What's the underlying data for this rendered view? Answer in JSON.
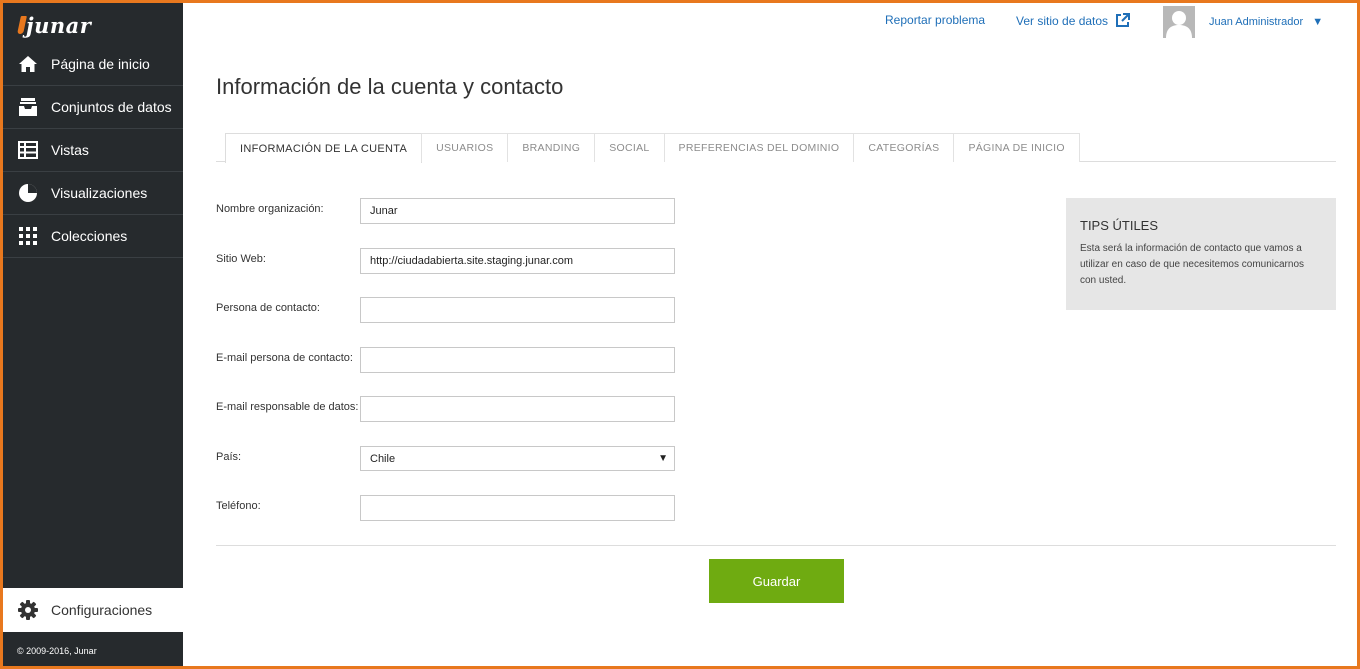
{
  "brand": {
    "logo_text": "junar",
    "accent": "#e8781e"
  },
  "sidebar": {
    "items": [
      {
        "label": "Página de inicio",
        "icon": "home-icon"
      },
      {
        "label": "Conjuntos de datos",
        "icon": "inbox-icon"
      },
      {
        "label": "Vistas",
        "icon": "table-icon"
      },
      {
        "label": "Visualizaciones",
        "icon": "pie-chart-icon"
      },
      {
        "label": "Colecciones",
        "icon": "grid-icon"
      }
    ],
    "settings_label": "Configuraciones",
    "copyright": "© 2009-2016, Junar"
  },
  "header": {
    "report_link": "Reportar problema",
    "view_site_link": "Ver sitio de datos",
    "user_name": "Juan Administrador",
    "user_caret": "▼"
  },
  "page": {
    "title": "Información de la cuenta y contacto"
  },
  "tabs": [
    {
      "label": "INFORMACIÓN DE LA CUENTA",
      "active": true
    },
    {
      "label": "USUARIOS"
    },
    {
      "label": "BRANDING"
    },
    {
      "label": "SOCIAL"
    },
    {
      "label": "PREFERENCIAS DEL DOMINIO"
    },
    {
      "label": "CATEGORÍAS"
    },
    {
      "label": "PÁGINA DE INICIO"
    }
  ],
  "form": {
    "org_name": {
      "label": "Nombre organización:",
      "value": "Junar"
    },
    "website": {
      "label": "Sitio Web:",
      "value": "http://ciudadabierta.site.staging.junar.com"
    },
    "contact_person": {
      "label": "Persona de contacto:",
      "value": ""
    },
    "contact_email": {
      "label": "E-mail persona de contacto:",
      "value": ""
    },
    "data_email": {
      "label": "E-mail responsable de datos:",
      "value": ""
    },
    "country": {
      "label": "País:",
      "value": "Chile",
      "arrow": "▼"
    },
    "phone": {
      "label": "Teléfono:",
      "value": ""
    }
  },
  "tips": {
    "title": "TIPS ÚTILES",
    "text": "Esta será la información de contacto que vamos a utilizar en caso de que necesitemos comunicarnos con usted."
  },
  "actions": {
    "save_label": "Guardar",
    "save_color": "#6fab11"
  }
}
